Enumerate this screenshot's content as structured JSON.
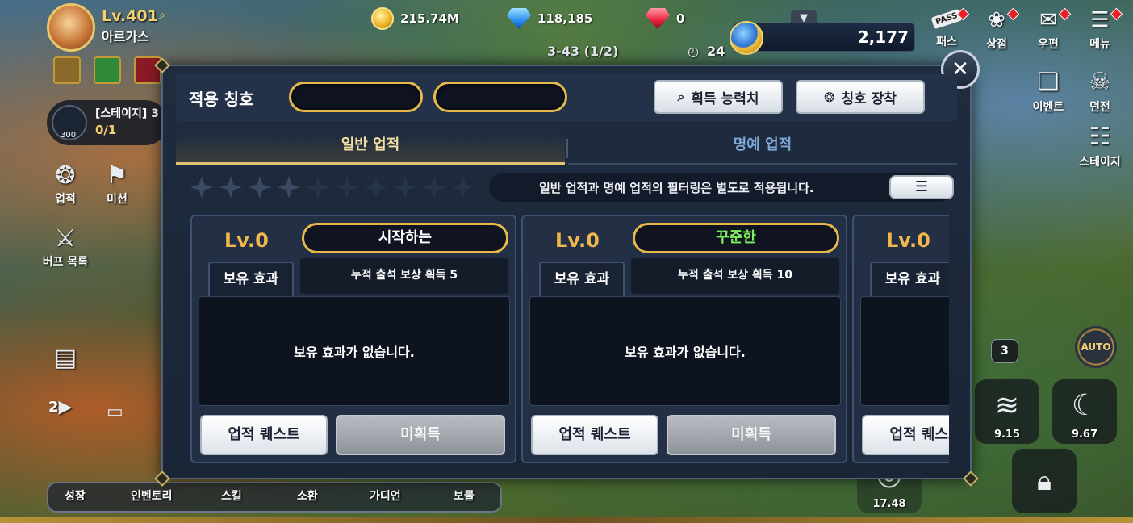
{
  "player": {
    "level": "Lv.401",
    "name": "아르가스"
  },
  "currencies": {
    "gold": "215.74M",
    "diamond": "118,185",
    "ruby": "0"
  },
  "stage": {
    "label": "3-43 (1/2)",
    "timer": "24"
  },
  "combat_power": "2,177",
  "top_menu": [
    {
      "label": "패스",
      "icon": "pass-icon",
      "tag": "PASS"
    },
    {
      "label": "상점",
      "icon": "shop-bag-icon"
    },
    {
      "label": "우편",
      "icon": "mail-icon"
    },
    {
      "label": "메뉴",
      "icon": "hamburger-menu-icon"
    }
  ],
  "side_left": {
    "stage_card": {
      "title": "[스테이지] 3",
      "progress": "0/1",
      "gem_count": "300"
    },
    "icons": [
      {
        "label": "업적",
        "icon": "achievement-icon"
      },
      {
        "label": "미션",
        "icon": "mission-icon"
      },
      {
        "label": "버프 목록",
        "icon": "buff-list-icon"
      }
    ],
    "chat_count": "2"
  },
  "side_right": {
    "icons": [
      {
        "label": "이벤트",
        "icon": "gift-icon"
      },
      {
        "label": "던전",
        "icon": "skull-icon"
      },
      {
        "label": "스테이지",
        "icon": "signpost-icon"
      }
    ],
    "skill_count": "3",
    "auto_label": "AUTO",
    "skills": [
      {
        "cooldown": "9.15",
        "icon": "tornado-skill-icon"
      },
      {
        "cooldown": "9.67",
        "icon": "slash-skill-icon"
      },
      {
        "cooldown": "17.48",
        "icon": "spin-skill-icon"
      }
    ]
  },
  "bottom_nav": [
    "성장",
    "인벤토리",
    "스킬",
    "소환",
    "가디언",
    "보물"
  ],
  "modal": {
    "header_label": "적용 칭호",
    "buttons": {
      "ability": "획득 능력치",
      "equip": "칭호 장착"
    },
    "tabs": {
      "normal": "일반 업적",
      "honor": "명예 업적"
    },
    "filter_notice": "일반 업적과 명예 업적의 필터링은 별도로 적용됩니다.",
    "stars_total": 10,
    "stars_filled": 4,
    "cards": [
      {
        "level": "Lv.0",
        "title": "시작하는",
        "title_color": "#ffffff",
        "tag": "보유 효과",
        "reward": "누적 출석 보상 획득 5",
        "effect": "보유 효과가 없습니다.",
        "quest_btn": "업적 퀘스트",
        "state_btn": "미획득"
      },
      {
        "level": "Lv.0",
        "title": "꾸준한",
        "title_color": "#7ef05a",
        "tag": "보유 효과",
        "reward": "누적 출석 보상 획득 10",
        "effect": "보유 효과가 없습니다.",
        "quest_btn": "업적 퀘스트",
        "state_btn": "미획득"
      },
      {
        "level": "Lv.0",
        "title": "",
        "title_color": "#ffffff",
        "tag": "보유 효과",
        "reward": "",
        "effect": "",
        "quest_btn": "업적 퀘스트",
        "state_btn": ""
      }
    ]
  },
  "colors": {
    "accent_gold": "#e6b94a",
    "level_orange": "#f0b84a",
    "tab_active": "#f3dfa4",
    "tab_inactive": "#7ea7d6"
  }
}
